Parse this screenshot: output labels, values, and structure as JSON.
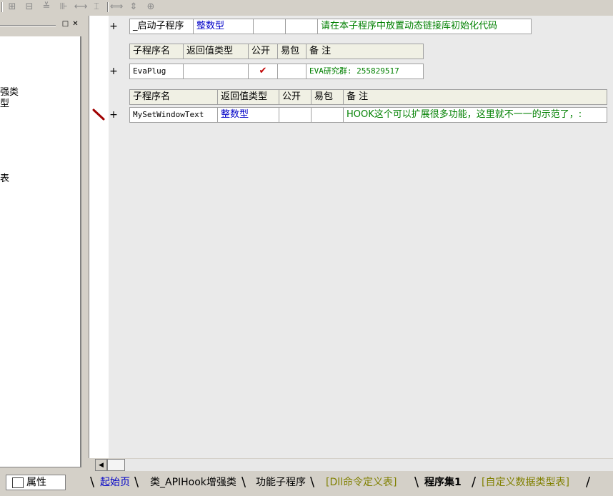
{
  "toolbar": {
    "icons": [
      "align-left-icon",
      "align-center-icon",
      "align-top-icon",
      "align-middle-icon",
      "same-width-icon",
      "same-height-icon",
      "horizontal-space-icon",
      "vertical-space-icon",
      "center-icon"
    ],
    "glyphs": [
      "⊞",
      "⊟",
      "≚",
      "⊪",
      "⟷",
      "⌶",
      "⟺",
      "⇕",
      "⊕"
    ]
  },
  "left_panel": {
    "tree_fragments": [
      "强类",
      "型",
      "表"
    ]
  },
  "editor": {
    "startup_row": {
      "name": "_启动子程序",
      "return_type": "整数型",
      "note": "请在本子程序中放置动态链接库初始化代码"
    },
    "table_headers": {
      "name": "子程序名",
      "return_type": "返回值类型",
      "public": "公开",
      "easy": "易包",
      "note": "备 注"
    },
    "sub1": {
      "name": "EvaPlug",
      "return_type": "",
      "public": "✔",
      "easy": "",
      "note": "EVA研究群: 255829517"
    },
    "sub2": {
      "name": "MySetWindowText",
      "return_type": "整数型",
      "public": "",
      "easy": "",
      "note": "HOOK这个可以扩展很多功能，这里就不一一的示范了，:"
    },
    "plus": "+"
  },
  "bottom": {
    "properties_label": "属性",
    "tabs": [
      {
        "label": "起始页",
        "color": "#0000c8"
      },
      {
        "label": "类_APIHook增强类",
        "color": "#000000"
      },
      {
        "label": "功能子程序",
        "color": "#000000"
      },
      {
        "label": "[Dll命令定义表]",
        "color": "#808000"
      },
      {
        "label": "程序集1",
        "color": "#000000",
        "active": true
      },
      {
        "label": "[自定义数据类型表]",
        "color": "#808000"
      }
    ]
  }
}
